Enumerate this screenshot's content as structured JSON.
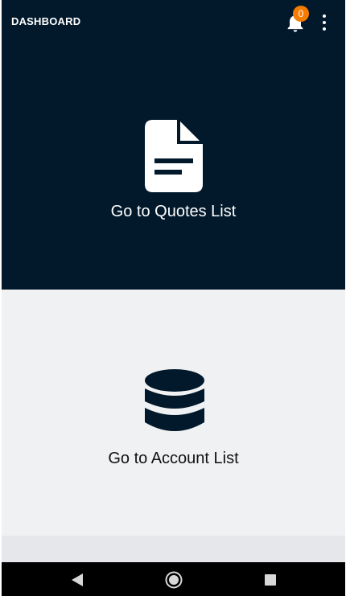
{
  "appbar": {
    "title": "DASHBOARD",
    "notification_count": "0",
    "bell_icon": "bell-icon",
    "menu_icon": "more-vert-icon"
  },
  "tiles": [
    {
      "label": "Go to Quotes List",
      "icon": "document-icon",
      "background": "#02192b",
      "text_color": "#ffffff"
    },
    {
      "label": "Go to Account List",
      "icon": "database-icon",
      "background": "#f0f1f3",
      "text_color": "#111111"
    }
  ],
  "navbar": {
    "back_icon": "back-triangle-icon",
    "home_icon": "home-circle-icon",
    "recents_icon": "recents-square-icon"
  },
  "colors": {
    "primary": "#02192b",
    "badge": "#f57c00",
    "light_bg": "#f0f1f3"
  }
}
